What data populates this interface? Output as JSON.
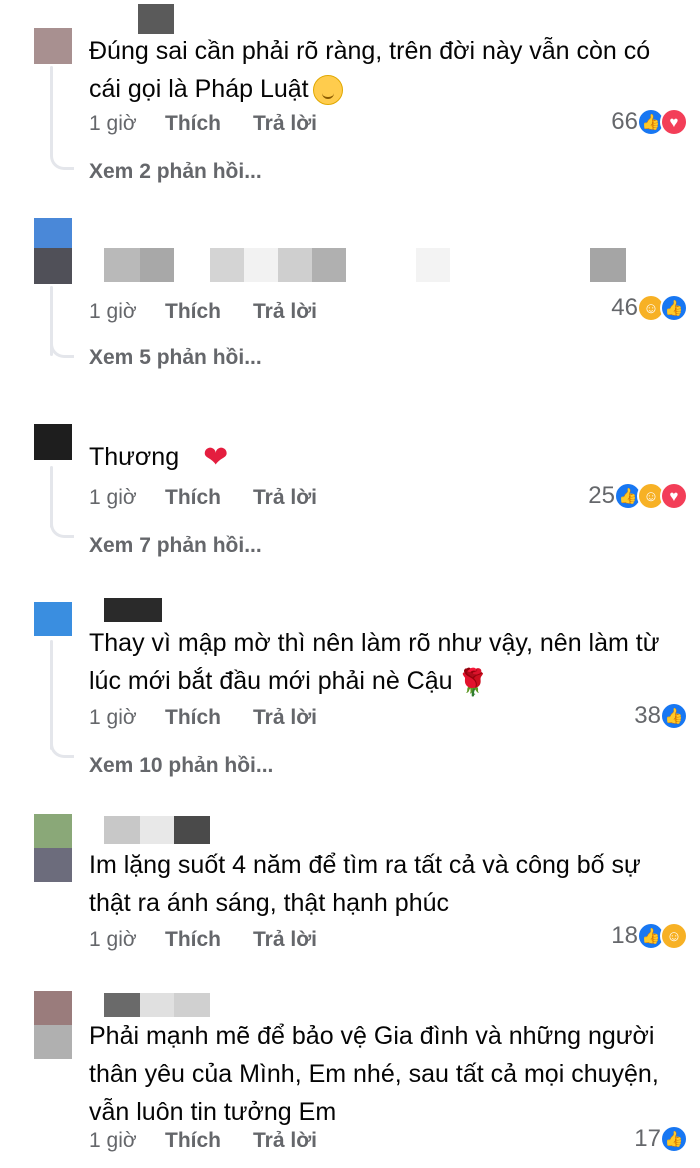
{
  "comments": [
    {
      "text": "Đúng sai cần phải rõ ràng, trên đời này vẫn còn có cái gọi là Pháp Luật",
      "time": "1 giờ",
      "like": "Thích",
      "reply": "Trả lời",
      "count": "66",
      "reactions": [
        "like-icon",
        "love-icon"
      ],
      "view_replies": "Xem 2 phản hồi...",
      "emoji": "smile-icon"
    },
    {
      "text": "",
      "time": "1 giờ",
      "like": "Thích",
      "reply": "Trả lời",
      "count": "46",
      "reactions": [
        "haha-icon",
        "like-icon"
      ],
      "view_replies": "Xem 5 phản hồi..."
    },
    {
      "text": "Thương",
      "time": "1 giờ",
      "like": "Thích",
      "reply": "Trả lời",
      "count": "25",
      "reactions": [
        "like-icon",
        "haha-icon",
        "love-icon"
      ],
      "view_replies": "Xem 7 phản hồi...",
      "emoji": "heart-icon"
    },
    {
      "text": "Thay vì mập mờ thì nên làm rõ như vậy, nên làm từ lúc mới bắt đầu mới phải nè Cậu",
      "time": "1 giờ",
      "like": "Thích",
      "reply": "Trả lời",
      "count": "38",
      "reactions": [
        "like-icon"
      ],
      "view_replies": "Xem 10 phản hồi...",
      "emoji": "rose-icon"
    },
    {
      "text": "Im lặng suốt 4 năm để tìm ra tất cả và công bố sự thật ra ánh sáng, thật hạnh phúc",
      "time": "1 giờ",
      "like": "Thích",
      "reply": "Trả lời",
      "count": "18",
      "reactions": [
        "like-icon",
        "haha-icon"
      ]
    },
    {
      "text": "Phải mạnh mẽ để bảo vệ Gia đình và những người thân yêu của Mình, Em nhé, sau tất cả mọi chuyện, vẫn luôn tin tưởng Em",
      "time": "1 giờ",
      "like": "Thích",
      "reply": "Trả lời",
      "count": "17",
      "reactions": [
        "like-icon"
      ]
    }
  ],
  "colors": {
    "like": "#1877f2",
    "love": "#f33e58",
    "haha": "#f7b125",
    "meta": "#65676b"
  }
}
